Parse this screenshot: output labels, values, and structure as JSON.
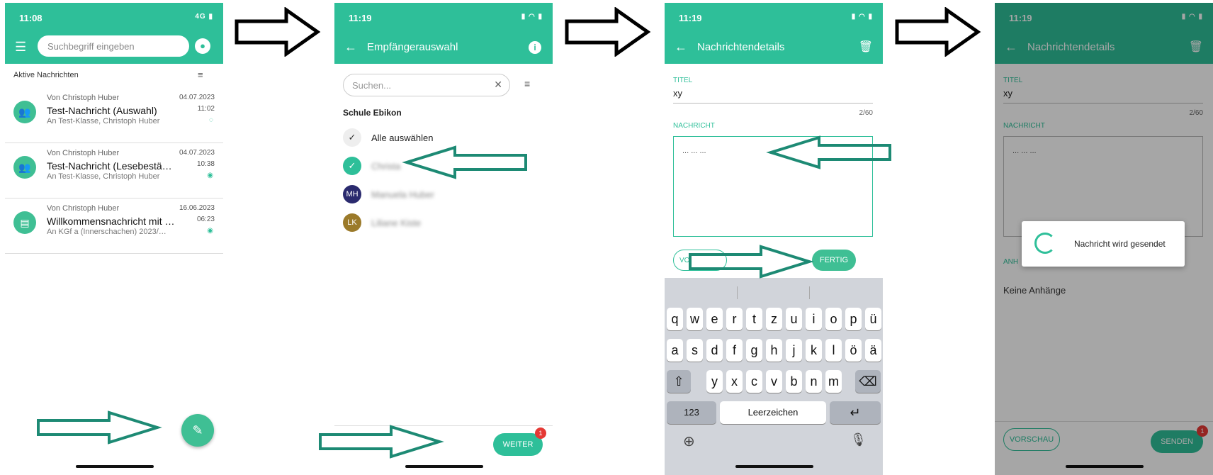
{
  "colors": {
    "primary": "#2ebf99",
    "overlay": "rgba(0,0,0,0.35)"
  },
  "s1": {
    "time": "11:08",
    "network": "4G",
    "search_placeholder": "Suchbegriff eingeben",
    "section": "Aktive Nachrichten",
    "messages": [
      {
        "from": "Von Christoph Huber",
        "subject": "Test-Nachricht (Auswahl)",
        "to": "An Test-Klasse, Christoph Huber",
        "date": "04.07.2023",
        "time": "11:02",
        "icon": "chat-bubble-icon"
      },
      {
        "from": "Von Christoph Huber",
        "subject": "Test-Nachricht (Lesebestä…",
        "to": "An Test-Klasse, Christoph Huber",
        "date": "04.07.2023",
        "time": "10:38",
        "icon": "eye-icon"
      },
      {
        "from": "Von Christoph Huber",
        "subject": "Willkommensnachricht mit …",
        "to": "An KGf a (Innerschachen) 2023/…",
        "date": "16.06.2023",
        "time": "06:23",
        "icon": "eye-icon"
      }
    ]
  },
  "s2": {
    "time": "11:19",
    "title": "Empfängerauswahl",
    "search_placeholder": "Suchen...",
    "school": "Schule Ebikon",
    "select_all": "Alle auswählen",
    "recipients": [
      {
        "initials": "",
        "name": "Christa",
        "color": "#2ebf99"
      },
      {
        "initials": "MH",
        "name": "Manuela Huber",
        "color": "#2a2a6e"
      },
      {
        "initials": "LK",
        "name": "Liliane Kiste",
        "color": "#9b7a2a"
      }
    ],
    "next_button": "WEITER",
    "badge": "1"
  },
  "s3": {
    "time": "11:19",
    "title": "Nachrichtendetails",
    "title_label": "TITEL",
    "title_value": "xy",
    "counter": "2/60",
    "message_label": "NACHRICHT",
    "message_value": "... ... ...",
    "preview_button": "VO",
    "done_button": "FERTIG",
    "keys_row1": [
      "q",
      "w",
      "e",
      "r",
      "t",
      "z",
      "u",
      "i",
      "o",
      "p",
      "ü"
    ],
    "keys_row2": [
      "a",
      "s",
      "d",
      "f",
      "g",
      "h",
      "j",
      "k",
      "l",
      "ö",
      "ä"
    ],
    "keys_row3": [
      "y",
      "x",
      "c",
      "v",
      "b",
      "n",
      "m"
    ],
    "num_key": "123",
    "space_key": "Leerzeichen"
  },
  "s4": {
    "time": "11:19",
    "title": "Nachrichtendetails",
    "title_label": "TITEL",
    "title_value": "xy",
    "counter": "2/60",
    "message_label": "NACHRICHT",
    "message_value": "... ... ...",
    "attachments_label": "ANH",
    "no_attachments": "Keine Anhänge",
    "dialog_text": "Nachricht wird gesendet",
    "preview_button": "VORSCHAU",
    "send_button": "SENDEN",
    "badge": "1"
  }
}
